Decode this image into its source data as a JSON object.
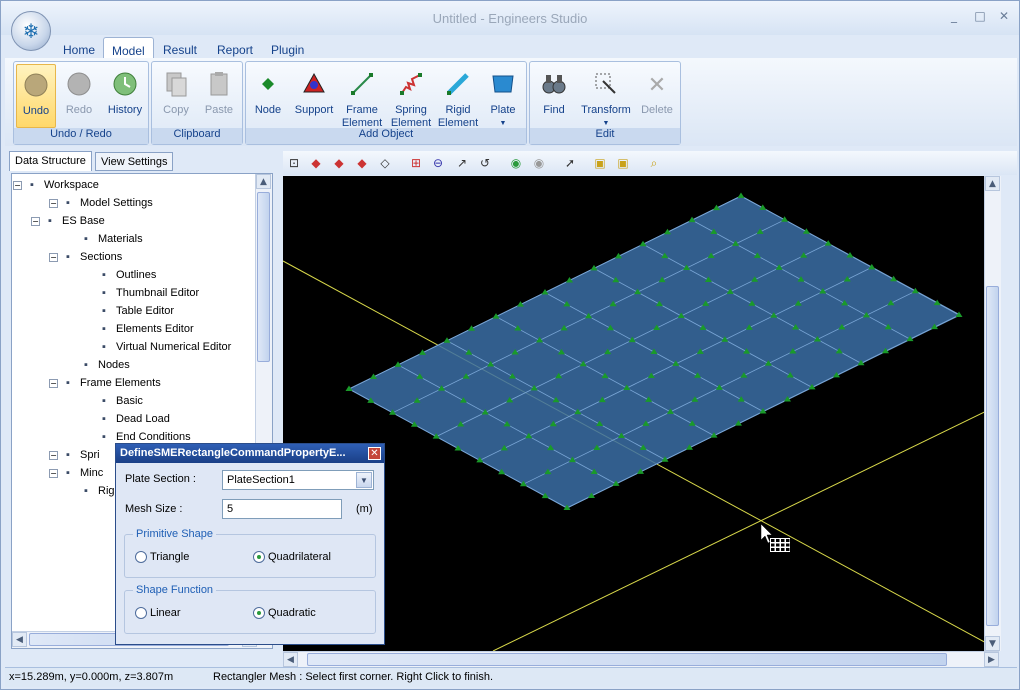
{
  "window": {
    "title": "Untitled - Engineers Studio",
    "minimize": "_",
    "maximize": "□",
    "close": "✕"
  },
  "menu_tabs": [
    "Home",
    "Model",
    "Result",
    "Report",
    "Plugin"
  ],
  "help_icon": "?",
  "ribbon": {
    "groups": [
      {
        "label": "Undo / Redo",
        "buttons": [
          {
            "label": "Undo",
            "icon": "undo-icon"
          },
          {
            "label": "Redo",
            "icon": "redo-icon"
          },
          {
            "label": "History",
            "icon": "history-icon"
          }
        ]
      },
      {
        "label": "Clipboard",
        "buttons": [
          {
            "label": "Copy",
            "icon": "copy-icon"
          },
          {
            "label": "Paste",
            "icon": "paste-icon"
          }
        ]
      },
      {
        "label": "Add Object",
        "buttons": [
          {
            "label": "Node",
            "icon": "node-icon"
          },
          {
            "label": "Support",
            "icon": "support-icon"
          },
          {
            "label": "Frame\nElement",
            "icon": "frame-element-icon"
          },
          {
            "label": "Spring\nElement",
            "icon": "spring-element-icon"
          },
          {
            "label": "Rigid\nElement",
            "icon": "rigid-element-icon"
          },
          {
            "label": "Plate",
            "icon": "plate-icon"
          }
        ]
      },
      {
        "label": "Edit",
        "buttons": [
          {
            "label": "Find",
            "icon": "find-icon"
          },
          {
            "label": "Transform",
            "icon": "transform-icon"
          },
          {
            "label": "Delete",
            "icon": "delete-icon"
          }
        ]
      }
    ]
  },
  "left_panel": {
    "tabs": [
      "Data Structure",
      "View Settings"
    ],
    "tree": [
      {
        "label": "Workspace",
        "level": 0
      },
      {
        "label": "Model Settings",
        "level": 2
      },
      {
        "label": "ES Base",
        "level": 1
      },
      {
        "label": "Materials",
        "level": 3
      },
      {
        "label": "Sections",
        "level": 2
      },
      {
        "label": "Outlines",
        "level": 4
      },
      {
        "label": "Thumbnail Editor",
        "level": 4
      },
      {
        "label": "Table Editor",
        "level": 4
      },
      {
        "label": "Elements Editor",
        "level": 4
      },
      {
        "label": "Virtual Numerical Editor",
        "level": 4
      },
      {
        "label": "Nodes",
        "level": 3
      },
      {
        "label": "Frame Elements",
        "level": 2
      },
      {
        "label": "Basic",
        "level": 4
      },
      {
        "label": "Dead Load",
        "level": 4
      },
      {
        "label": "End Conditions",
        "level": 4
      },
      {
        "label": "Spri",
        "level": 2
      },
      {
        "label": "Minc",
        "level": 2
      },
      {
        "label": "Rigi",
        "level": 3
      }
    ]
  },
  "dialog": {
    "title": "DefineSMERectangleCommandPropertyE...",
    "close": "✕",
    "plate_section_label": "Plate Section :",
    "plate_section_value": "PlateSection1",
    "mesh_size_label": "Mesh Size :",
    "mesh_size_value": "5",
    "mesh_size_unit": "(m)",
    "primitive_shape": {
      "legend": "Primitive Shape",
      "options": [
        "Triangle",
        "Quadrilateral"
      ],
      "selected": "Quadrilateral"
    },
    "shape_function": {
      "legend": "Shape Function",
      "options": [
        "Linear",
        "Quadratic"
      ],
      "selected": "Quadratic"
    }
  },
  "status": {
    "coords": "x=15.289m, y=0.000m, z=3.807m",
    "message": "Rectangler Mesh : Select first corner. Right Click to finish."
  },
  "colors": {
    "plate": "#3b6fa6",
    "node": "#1a9a2a",
    "axis": "#d8d84a",
    "background": "#000000"
  }
}
